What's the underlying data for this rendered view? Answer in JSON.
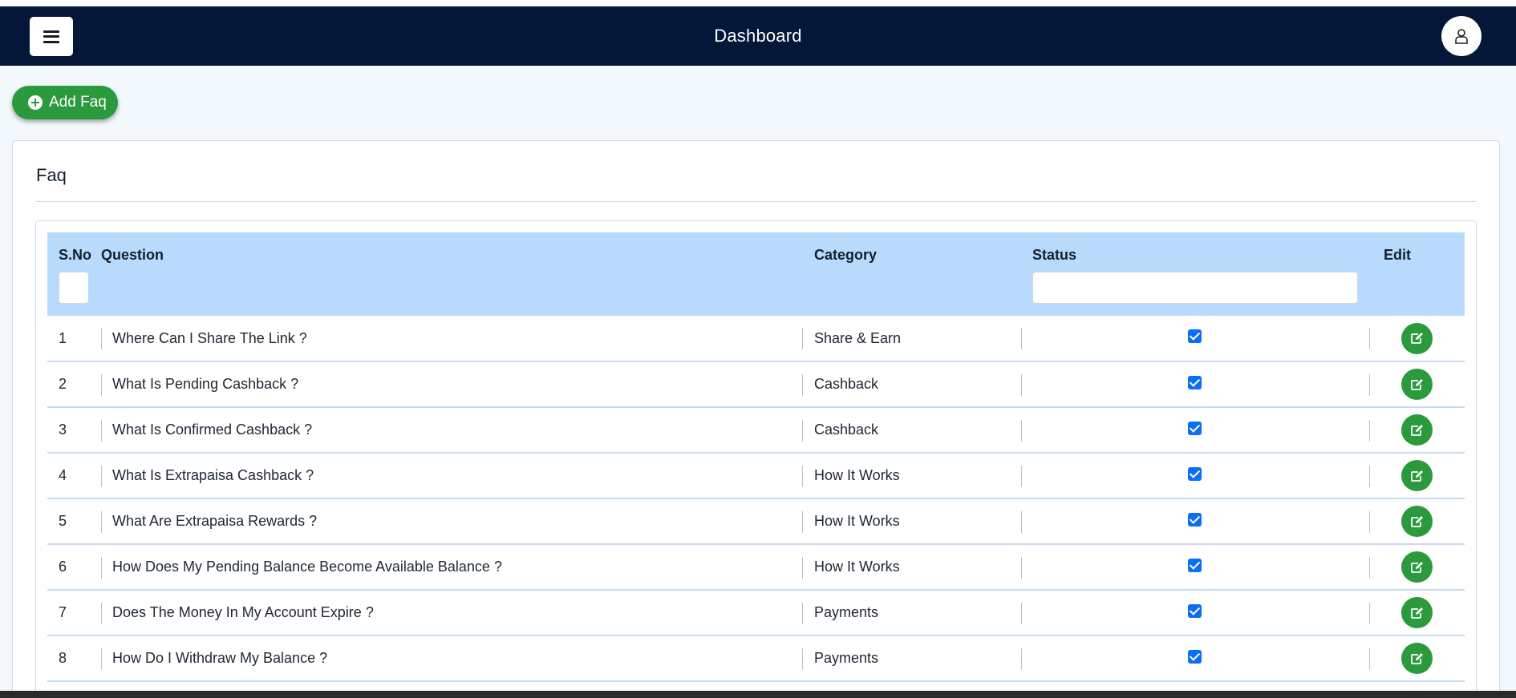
{
  "navbar": {
    "title": "Dashboard",
    "menu_icon": "hamburger-menu-icon",
    "user_icon": "user-icon",
    "bg_color": "#041738"
  },
  "actions": {
    "add_label": "Add Faq",
    "add_icon": "plus-circle-icon",
    "accent_color": "#2a9a3c"
  },
  "card": {
    "title": "Faq"
  },
  "table": {
    "columns": {
      "sno": "S.No",
      "question": "Question",
      "category": "Category",
      "status": "Status",
      "edit": "Edit"
    },
    "filters": {
      "sno": "",
      "status": ""
    },
    "header_bg": "#b8dafc",
    "rows": [
      {
        "sno": "1",
        "question": "Where Can I Share The Link ?",
        "category": "Share & Earn",
        "status": true
      },
      {
        "sno": "2",
        "question": "What Is Pending Cashback ?",
        "category": "Cashback",
        "status": true
      },
      {
        "sno": "3",
        "question": "What Is Confirmed Cashback ?",
        "category": "Cashback",
        "status": true
      },
      {
        "sno": "4",
        "question": "What Is Extrapaisa Cashback ?",
        "category": "How It Works",
        "status": true
      },
      {
        "sno": "5",
        "question": "What Are Extrapaisa Rewards ?",
        "category": "How It Works",
        "status": true
      },
      {
        "sno": "6",
        "question": "How Does My Pending Balance Become Available Balance ?",
        "category": "How It Works",
        "status": true
      },
      {
        "sno": "7",
        "question": "Does The Money In My Account Expire ?",
        "category": "Payments",
        "status": true
      },
      {
        "sno": "8",
        "question": "How Do I Withdraw My Balance ?",
        "category": "Payments",
        "status": true
      }
    ],
    "edit_icon": "edit-icon"
  }
}
